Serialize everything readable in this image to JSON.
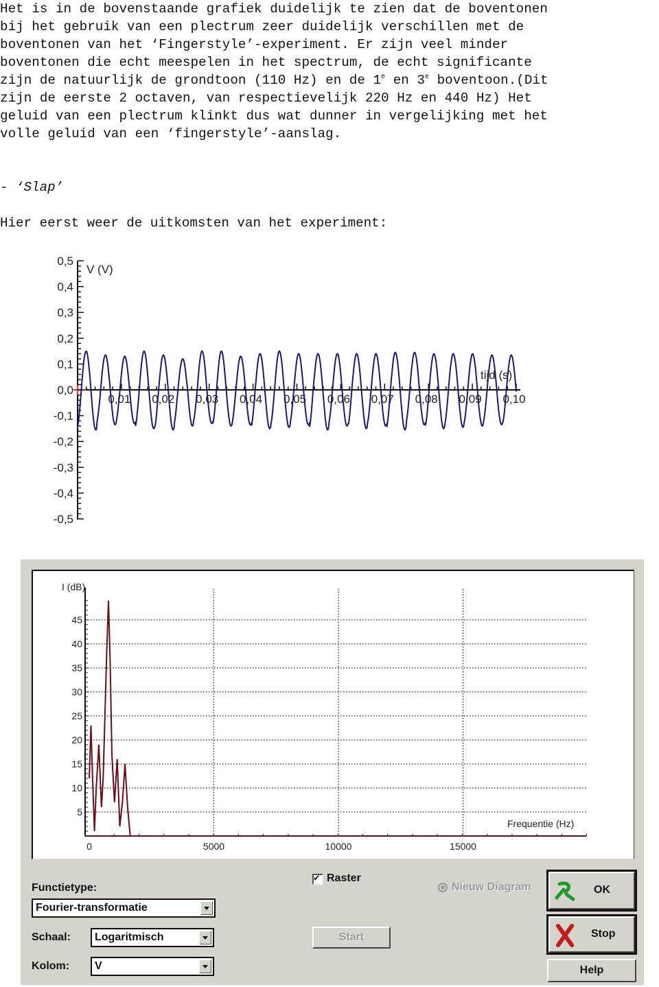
{
  "document": {
    "paragraph_lines": [
      "Het is in de bovenstaande grafiek duidelijk te zien dat de boventonen",
      "bij het gebruik van een plectrum zeer duidelijk verschillen met de",
      "boventonen van het ‘Fingerstyle’-experiment. Er zijn veel minder",
      "boventonen die echt meespelen in het spectrum, de echt significante"
    ],
    "line5_a": "zijn de natuurlijk de grondtoon (110 Hz) en de 1",
    "line5_sup1": "e",
    "line5_b": " en 3",
    "line5_sup2": "e",
    "line5_c": " boventoon.(Dit",
    "paragraph_tail": [
      "zijn de eerste 2 octaven, van respectievelijk 220 Hz en 440 Hz) Het",
      "geluid van een plectrum klinkt dus wat dunner in vergelijking met het",
      "volle geluid van een ‘fingerstyle’-aanslag."
    ],
    "section_dash": "- ",
    "section_title": "‘Slap’",
    "intro_text": "Hier eerst weer de uitkomsten van het experiment:"
  },
  "chart_data": [
    {
      "type": "line",
      "title": "",
      "xlabel": "tijd (s)",
      "ylabel": "V (V)",
      "xlim": [
        0,
        0.1
      ],
      "ylim": [
        -0.5,
        0.5
      ],
      "x_ticks": [
        "0,01",
        "0,02",
        "0,03",
        "0,04",
        "0,05",
        "0,06",
        "0,07",
        "0,08",
        "0,09",
        "0,10"
      ],
      "y_ticks": [
        "0,5",
        "0,4",
        "0,3",
        "0,2",
        "0,1",
        "0,0",
        "-0,1",
        "-0,2",
        "-0,3",
        "-0,4",
        "-0,5"
      ],
      "series": [
        {
          "name": "V",
          "color": "#1a1a6e",
          "frequency_hz": 227,
          "peaks": [
            0.15,
            0.135,
            0.13,
            0.15,
            0.135,
            0.12,
            0.15,
            0.15,
            0.13,
            0.14,
            0.15,
            0.14,
            0.14,
            0.14,
            0.14,
            0.14,
            0.145,
            0.145,
            0.14,
            0.14,
            0.14,
            0.135,
            0.135
          ],
          "troughs": [
            -0.155,
            -0.135,
            -0.13,
            -0.15,
            -0.155,
            -0.14,
            -0.13,
            -0.14,
            -0.135,
            -0.15,
            -0.145,
            -0.135,
            -0.155,
            -0.14,
            -0.15,
            -0.14,
            -0.155,
            -0.135,
            -0.15,
            -0.145,
            -0.14,
            -0.135,
            -0.14
          ]
        }
      ],
      "grid": false,
      "origin_marker_color": "#e03030"
    },
    {
      "type": "line",
      "title": "",
      "xlabel": "Frequentie (Hz)",
      "ylabel": "I (dB)",
      "xlim": [
        0,
        20000
      ],
      "ylim": [
        0,
        50
      ],
      "x_ticks": [
        "0",
        "5000",
        "10000",
        "15000"
      ],
      "x_tick_values": [
        0,
        5000,
        10000,
        15000
      ],
      "y_ticks": [
        "5",
        "10",
        "15",
        "20",
        "25",
        "30",
        "35",
        "40",
        "45"
      ],
      "y_tick_values": [
        5,
        10,
        15,
        20,
        25,
        30,
        35,
        40,
        45
      ],
      "grid": true,
      "series": [
        {
          "name": "I",
          "color": "#6b0d16",
          "points": [
            [
              0,
              12
            ],
            [
              20,
              23
            ],
            [
              40,
              11
            ],
            [
              60,
              1
            ],
            [
              80,
              10
            ],
            [
              110,
              19
            ],
            [
              140,
              6
            ],
            [
              160,
              12
            ],
            [
              200,
              38
            ],
            [
              220,
              49
            ],
            [
              240,
              36
            ],
            [
              260,
              17
            ],
            [
              290,
              7
            ],
            [
              320,
              16
            ],
            [
              350,
              2
            ],
            [
              380,
              7
            ],
            [
              410,
              15
            ],
            [
              440,
              6
            ],
            [
              470,
              0
            ],
            [
              500,
              0
            ]
          ]
        }
      ]
    }
  ],
  "dialog": {
    "functietype_label": "Functietype:",
    "functietype_value": "Fourier-transformatie",
    "schaal_label": "Schaal:",
    "schaal_value": "Logaritmisch",
    "kolom_label": "Kolom:",
    "kolom_value": "V",
    "raster_label": "Raster",
    "raster_checked": true,
    "nieuw_diagram_label": "Nieuw Diagram",
    "start_label": "Start",
    "ok_label": "OK",
    "stop_label": "Stop",
    "help_label": "Help",
    "ok_icon": "green-check-icon",
    "stop_icon": "red-x-icon"
  }
}
